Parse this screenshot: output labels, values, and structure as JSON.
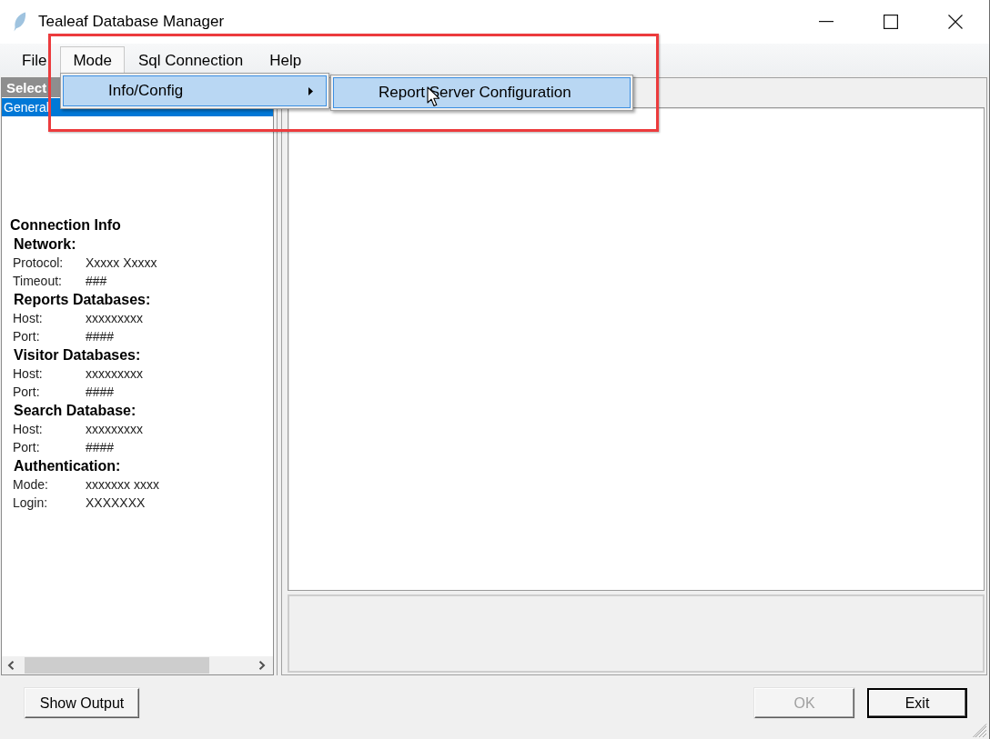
{
  "window": {
    "title": "Tealeaf Database Manager"
  },
  "menu_bar": [
    {
      "label": "File",
      "selected": false
    },
    {
      "label": "Mode",
      "selected": true
    },
    {
      "label": "Sql Connection",
      "selected": false
    },
    {
      "label": "Help",
      "selected": false
    }
  ],
  "open_menu": {
    "items": [
      {
        "label": "Info/Config",
        "selected": true,
        "has_submenu": true
      }
    ]
  },
  "submenu": {
    "items": [
      {
        "label": "Report Server Configuration",
        "selected": true
      }
    ]
  },
  "left_panel": {
    "header": "Select",
    "list": [
      {
        "label": "General",
        "selected": true
      }
    ],
    "connection_info": {
      "title": "Connection Info",
      "sections": [
        {
          "heading": "Network:",
          "fields": [
            {
              "label": "Protocol:",
              "value": "Xxxxx Xxxxx"
            },
            {
              "label": "Timeout:",
              "value": "###"
            }
          ]
        },
        {
          "heading": "Reports Databases:",
          "fields": [
            {
              "label": "Host:",
              "value": "xxxxxxxxx"
            },
            {
              "label": "Port:",
              "value": "####"
            }
          ]
        },
        {
          "heading": "Visitor Databases:",
          "fields": [
            {
              "label": "Host:",
              "value": "xxxxxxxxx"
            },
            {
              "label": "Port:",
              "value": "####"
            }
          ]
        },
        {
          "heading": "Search Database:",
          "fields": [
            {
              "label": "Host:",
              "value": "xxxxxxxxx"
            },
            {
              "label": "Port:",
              "value": "####"
            }
          ]
        },
        {
          "heading": "Authentication:",
          "fields": [
            {
              "label": "Mode:",
              "value": "xxxxxxx xxxx"
            },
            {
              "label": "Login:",
              "value": "XXXXXXX"
            }
          ]
        }
      ]
    }
  },
  "left_buttons": [
    {
      "label": "Show Output",
      "disabled": false,
      "default": false
    }
  ],
  "right_buttons": [
    {
      "label": "OK",
      "disabled": true,
      "default": false
    },
    {
      "label": "Exit",
      "disabled": false,
      "default": true
    }
  ]
}
